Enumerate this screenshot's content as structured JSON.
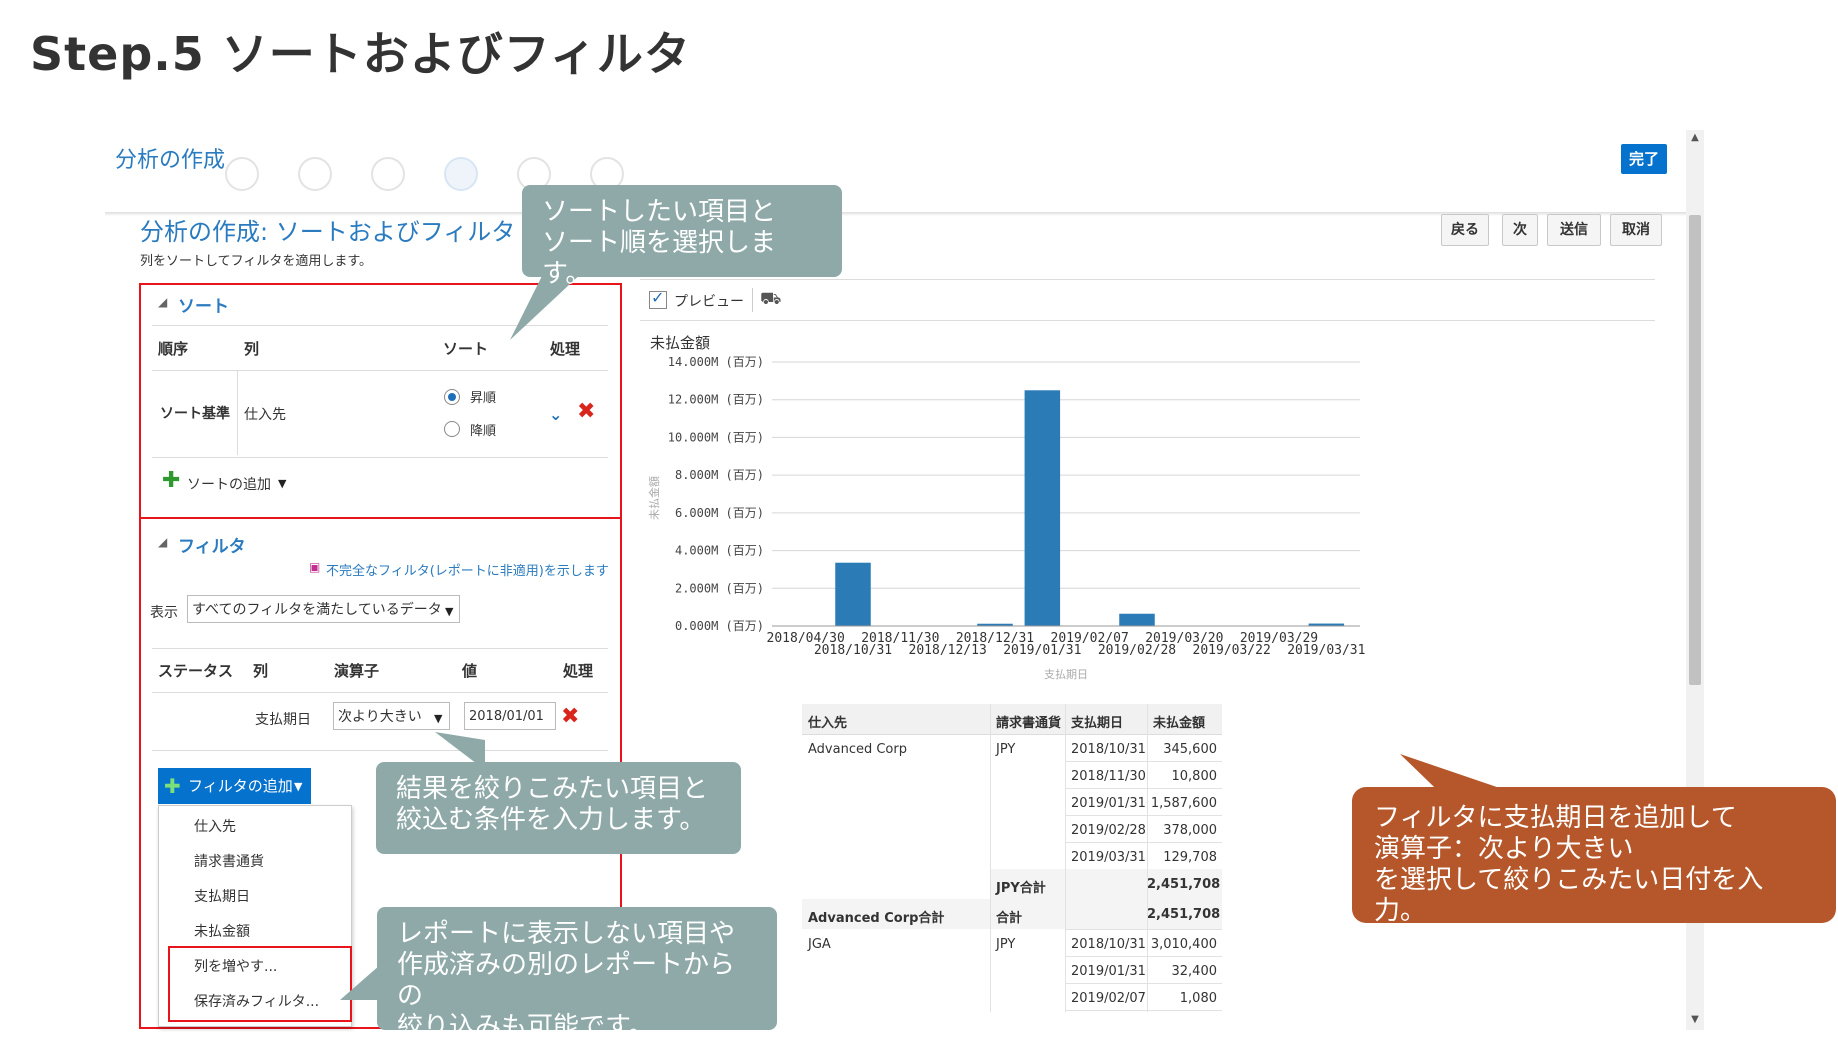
{
  "slide": {
    "title": "Step.5 ソートおよびフィルタ"
  },
  "dialog": {
    "title": "分析の作成",
    "done_button": "完了",
    "subtitle": "分析の作成: ソートおよびフィルタ",
    "description": "列をソートしてフィルタを適用します。",
    "nav_buttons": {
      "back": "戻る",
      "next": "次",
      "submit": "送信",
      "cancel": "取消"
    }
  },
  "sort": {
    "section_title": "ソート",
    "headers": {
      "order": "順序",
      "column": "列",
      "sort": "ソート",
      "action": "処理"
    },
    "row": {
      "order": "ソート基準",
      "column": "仕入先",
      "asc": "昇順",
      "desc": "降順",
      "selected": "asc"
    },
    "add_label": "ソートの追加"
  },
  "filter": {
    "section_title": "フィルタ",
    "incomplete_note": "不完全なフィルタ(レポートに非適用)を示します",
    "display_label": "表示",
    "display_value": "すべてのフィルタを満たしているデータ",
    "headers": {
      "status": "ステータス",
      "column": "列",
      "operator": "演算子",
      "value": "値",
      "action": "処理"
    },
    "row": {
      "column": "支払期日",
      "operator": "次より大きい",
      "value": "2018/01/01"
    },
    "add_button": "フィルタの追加",
    "menu_items": [
      "仕入先",
      "請求書通貨",
      "支払期日",
      "未払金額",
      "列を増やす...",
      "保存済みフィルタ..."
    ]
  },
  "preview": {
    "label": "プレビュー",
    "checked": true
  },
  "chart_data": {
    "type": "bar",
    "title": "未払金額",
    "xlabel": "支払期日",
    "ylabel": "未払金額",
    "ylim": [
      0,
      14000000
    ],
    "yticks": [
      "0.000M (百万)",
      "2.000M (百万)",
      "4.000M (百万)",
      "6.000M (百万)",
      "8.000M (百万)",
      "10.000M (百万)",
      "12.000M (百万)",
      "14.000M (百万)"
    ],
    "categories": [
      "2018/04/30",
      "2018/10/31",
      "2018/11/30",
      "2018/12/13",
      "2018/12/31",
      "2019/01/31",
      "2019/02/07",
      "2019/02/28",
      "2019/03/20",
      "2019/03/22",
      "2019/03/29",
      "2019/03/31"
    ],
    "values": [
      0,
      3356000,
      10800,
      0,
      120000,
      12500000,
      1080,
      650000,
      0,
      0,
      0,
      129708
    ],
    "color": "#2a7bb6"
  },
  "table": {
    "headers": [
      "仕入先",
      "請求書通貨",
      "支払期日",
      "未払金額"
    ],
    "rows": [
      {
        "vendor": "Advanced Corp",
        "currency": "JPY",
        "date": "2018/10/31",
        "amount": "345,600"
      },
      {
        "vendor": "",
        "currency": "",
        "date": "2018/11/30",
        "amount": "10,800"
      },
      {
        "vendor": "",
        "currency": "",
        "date": "2019/01/31",
        "amount": "1,587,600"
      },
      {
        "vendor": "",
        "currency": "",
        "date": "2019/02/28",
        "amount": "378,000"
      },
      {
        "vendor": "",
        "currency": "",
        "date": "2019/03/31",
        "amount": "129,708"
      },
      {
        "vendor": "",
        "currency": "JPY合計",
        "date": "",
        "amount": "2,451,708"
      },
      {
        "vendor": "Advanced Corp合計",
        "currency": "合計",
        "date": "",
        "amount": "2,451,708"
      },
      {
        "vendor": "JGA",
        "currency": "JPY",
        "date": "2018/10/31",
        "amount": "3,010,400"
      },
      {
        "vendor": "",
        "currency": "",
        "date": "2019/01/31",
        "amount": "32,400"
      },
      {
        "vendor": "",
        "currency": "",
        "date": "2019/02/07",
        "amount": "1,080"
      }
    ]
  },
  "callouts": {
    "sort": "ソートしたい項目と\nソート順を選択します。",
    "filter": "結果を絞りこみたい項目と\n絞込む条件を入力します。",
    "more": "レポートに表示しない項目や\n作成済みの別のレポートからの\n絞り込みも可能です。",
    "date": "フィルタに支払期日を追加して\n演算子：次より大きい\nを選択して絞りこみたい日付を入力。"
  }
}
